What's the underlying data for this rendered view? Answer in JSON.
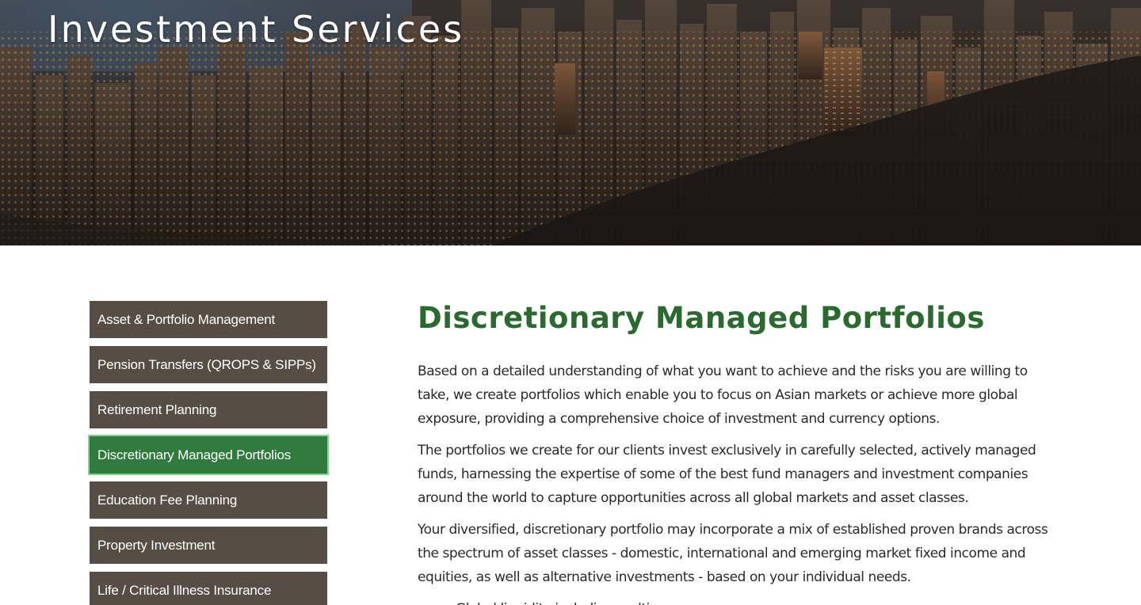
{
  "hero": {
    "title": "Investment Services"
  },
  "sidebar": {
    "items": [
      {
        "label": "Asset & Portfolio Management",
        "active": false
      },
      {
        "label": "Pension Transfers (QROPS & SIPPs)",
        "active": false
      },
      {
        "label": "Retirement Planning",
        "active": false
      },
      {
        "label": "Discretionary Managed Portfolios",
        "active": true
      },
      {
        "label": "Education Fee Planning",
        "active": false
      },
      {
        "label": "Property Investment",
        "active": false
      },
      {
        "label": "Life / Critical Illness Insurance",
        "active": false
      }
    ]
  },
  "content": {
    "title": "Discretionary Managed Portfolios",
    "paragraphs": [
      "Based on a detailed understanding of what you want to achieve and the risks you are willing to take, we create portfolios which enable you to focus on Asian markets or achieve more global exposure, providing a comprehensive choice of investment and currency options.",
      "The portfolios we create for our clients invest exclusively in carefully selected, actively managed funds, harnessing the expertise of some of the best fund managers and investment companies around the world to capture opportunities across all global markets and asset classes.",
      "Your diversified, discretionary portfolio may incorporate a mix of established proven brands across the spectrum of asset classes - domestic, international and emerging market fixed income and equities, as well as alternative investments - based on your individual needs."
    ],
    "bullets": [
      "Global liquidity including multi-"
    ]
  },
  "colors": {
    "nav_bg": "#564d45",
    "nav_active_bg": "#2f7a3c",
    "nav_active_outline": "#7fd68a",
    "title_green": "#2a6a2e",
    "body_text": "#2a2a2a"
  }
}
